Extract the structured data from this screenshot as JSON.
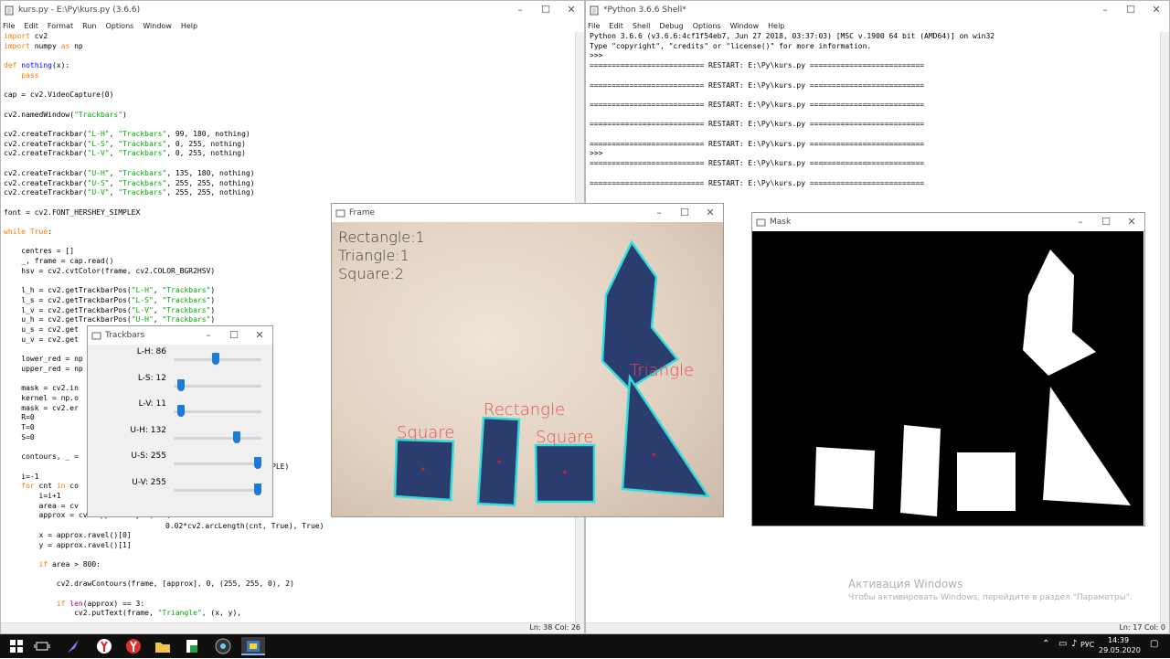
{
  "editor": {
    "title": "kurs.py - E:\\Py\\kurs.py (3.6.6)",
    "menu": [
      "File",
      "Edit",
      "Format",
      "Run",
      "Options",
      "Window",
      "Help"
    ],
    "status": "Ln: 38   Col: 26"
  },
  "shell": {
    "title": "*Python 3.6.6 Shell*",
    "menu": [
      "File",
      "Edit",
      "Shell",
      "Debug",
      "Options",
      "Window",
      "Help"
    ],
    "line1": "Python 3.6.6 (v3.6.6:4cf1f54eb7, Jun 27 2018, 03:37:03) [MSC v.1900 64 bit (AMD64)] on win32",
    "line2": "Type \"copyright\", \"credits\" or \"license()\" for more information.",
    "prompt": ">>>",
    "restart": "========================== RESTART: E:\\Py\\kurs.py ==========================",
    "status": "Ln: 17   Col: 0"
  },
  "frame": {
    "title": "Frame",
    "counts": [
      "Rectangle:1",
      "Triangle:1",
      "Square:2"
    ],
    "labels": {
      "triangle": "Triangle",
      "rectangle": "Rectangle",
      "square": "Square"
    }
  },
  "mask": {
    "title": "Mask"
  },
  "trackbars": {
    "title": "Trackbars",
    "items": [
      {
        "label": "L-H: 86",
        "value": 86,
        "max": 180
      },
      {
        "label": "L-S: 12",
        "value": 12,
        "max": 255
      },
      {
        "label": "L-V: 11",
        "value": 11,
        "max": 255
      },
      {
        "label": "U-H: 132",
        "value": 132,
        "max": 180
      },
      {
        "label": "U-S: 255",
        "value": 255,
        "max": 255
      },
      {
        "label": "U-V: 255",
        "value": 255,
        "max": 255
      }
    ]
  },
  "watermark": {
    "line1": "Активация Windows",
    "line2": "Чтобы активировать Windows, перейдите в раздел \"Параметры\"."
  },
  "taskbar": {
    "lang": "РУС",
    "time": "14:39",
    "date": "29.05.2020"
  },
  "code_tail": {
    "ple": "PLE)",
    "approx_cont": "0.02*cv2.arcLength(cnt, True), True)"
  }
}
